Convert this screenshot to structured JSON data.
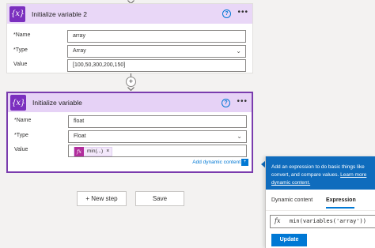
{
  "actions": [
    {
      "title": "Initialize variable 2",
      "fields": [
        {
          "label": "*Name",
          "value": "array"
        },
        {
          "label": "*Type",
          "value": "Array"
        },
        {
          "label": "Value",
          "value": "[100,50,300,200,150]"
        }
      ]
    },
    {
      "title": "Initialize variable",
      "fields": [
        {
          "label": "*Name",
          "value": "float"
        },
        {
          "label": "*Type",
          "value": "Float"
        },
        {
          "label": "Value",
          "token": "min(...)"
        }
      ],
      "add_dynamic_label": "Add dynamic content"
    }
  ],
  "buttons": {
    "new_step": "+ New step",
    "save": "Save"
  },
  "expression_panel": {
    "info_line1": "Add an expression to do basic things like",
    "info_line2": "convert, and compare values.",
    "learn_more": "Learn more",
    "info_line3": "dynamic content.",
    "tabs": [
      "Dynamic content",
      "Expression"
    ],
    "active_tab": "Expression",
    "fx_label": "fx",
    "expression": "min(variables('array'))",
    "update_label": "Update"
  },
  "icons": {
    "variable": "variable-icon",
    "help": "help-icon",
    "more": "more-options-icon",
    "plus": "add-step-icon",
    "arrow": "arrow-down-icon",
    "fx": "function-icon",
    "chevron": "chevron-down-icon"
  },
  "colors": {
    "accent": "#0078d4",
    "variable": "#7b2fbf",
    "header": "#e9d7f7",
    "selected_border": "#7a3cae",
    "token": "#b12d9c"
  }
}
